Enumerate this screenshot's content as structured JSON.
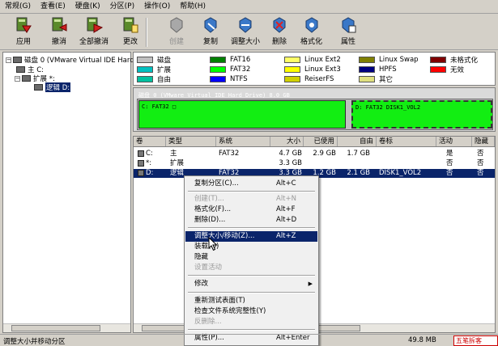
{
  "menubar": {
    "items": [
      "常规(G)",
      "查看(E)",
      "硬盘(K)",
      "分区(P)",
      "操作(O)",
      "帮助(H)"
    ]
  },
  "toolbar": {
    "apply": "应用",
    "undo": "撤消",
    "undo_all": "全部撤消",
    "changes": "更改",
    "create": "创建",
    "copy": "复制",
    "resize": "调整大小",
    "delete": "删除",
    "format": "格式化",
    "properties": "属性"
  },
  "tree": {
    "disk": "磁盘 0 (VMware Virtual IDE Hard",
    "primary": "主 C:",
    "extended": "扩展 *:",
    "logical": "逻辑 D:"
  },
  "legend": [
    {
      "label": "磁盘",
      "color": "#c0c0c0"
    },
    {
      "label": "FAT16",
      "color": "#008000"
    },
    {
      "label": "Linux Ext2",
      "color": "#ffff66"
    },
    {
      "label": "Linux Swap",
      "color": "#808000"
    },
    {
      "label": "未格式化",
      "color": "#800000"
    },
    {
      "label": "扩展",
      "color": "#00c0c0"
    },
    {
      "label": "FAT32",
      "color": "#00ff00"
    },
    {
      "label": "Linux Ext3",
      "color": "#ffff00"
    },
    {
      "label": "HPFS",
      "color": "#000080"
    },
    {
      "label": "无效",
      "color": "#ff0000"
    },
    {
      "label": "自由",
      "color": "#00c0a0"
    },
    {
      "label": "NTFS",
      "color": "#0000ff"
    },
    {
      "label": "ReiserFS",
      "color": "#d0d000"
    },
    {
      "label": "其它",
      "color": "#e0e080"
    }
  ],
  "diskmap": {
    "title": "磁盘 0 (VMware Virtual IDE Hard Drive) 8.0 GB",
    "c_label": "C: FAT32 □",
    "d_label": "D: FAT32 DISK1_VOL2"
  },
  "list": {
    "headers": [
      "卷",
      "类型",
      "系统",
      "大小",
      "已使用",
      "自由",
      "卷标",
      "活动",
      "隐藏"
    ],
    "rows": [
      {
        "vol": "C:",
        "type": "主",
        "fs": "FAT32",
        "size": "4.7 GB",
        "used": "2.9 GB",
        "free": "1.7 GB",
        "label": "",
        "active": "是",
        "hidden": "否"
      },
      {
        "vol": "*:",
        "type": "扩展",
        "fs": "",
        "size": "3.3 GB",
        "used": "",
        "free": "",
        "label": "",
        "active": "否",
        "hidden": "否"
      },
      {
        "vol": "D:",
        "type": "逻辑",
        "fs": "FAT32",
        "size": "3.3 GB",
        "used": "1.2 GB",
        "free": "2.1 GB",
        "label": "DISK1_VOL2",
        "active": "否",
        "hidden": "否"
      }
    ]
  },
  "context_menu": {
    "copy_partition": "复制分区(C)...",
    "copy_shortcut": "Alt+C",
    "create": "创建(T)...",
    "create_shortcut": "Alt+N",
    "format": "格式化(F)...",
    "format_shortcut": "Alt+F",
    "delete": "删除(D)...",
    "delete_shortcut": "Alt+D",
    "resize_move": "调整大小/移动(Z)...",
    "resize_shortcut": "Alt+Z",
    "mount": "装载(O)",
    "hide": "隐藏",
    "set_active": "设置活动",
    "modify": "修改",
    "retest_surface": "重新测试表面(T)",
    "check_fs": "检查文件系统完整性(Y)",
    "undelete": "反删除...",
    "properties": "属性(P)...",
    "properties_shortcut": "Alt+Enter"
  },
  "statusbar": {
    "text": "调整大小并移动分区",
    "free": "49.8 MB",
    "logo": "五笔拆客"
  }
}
